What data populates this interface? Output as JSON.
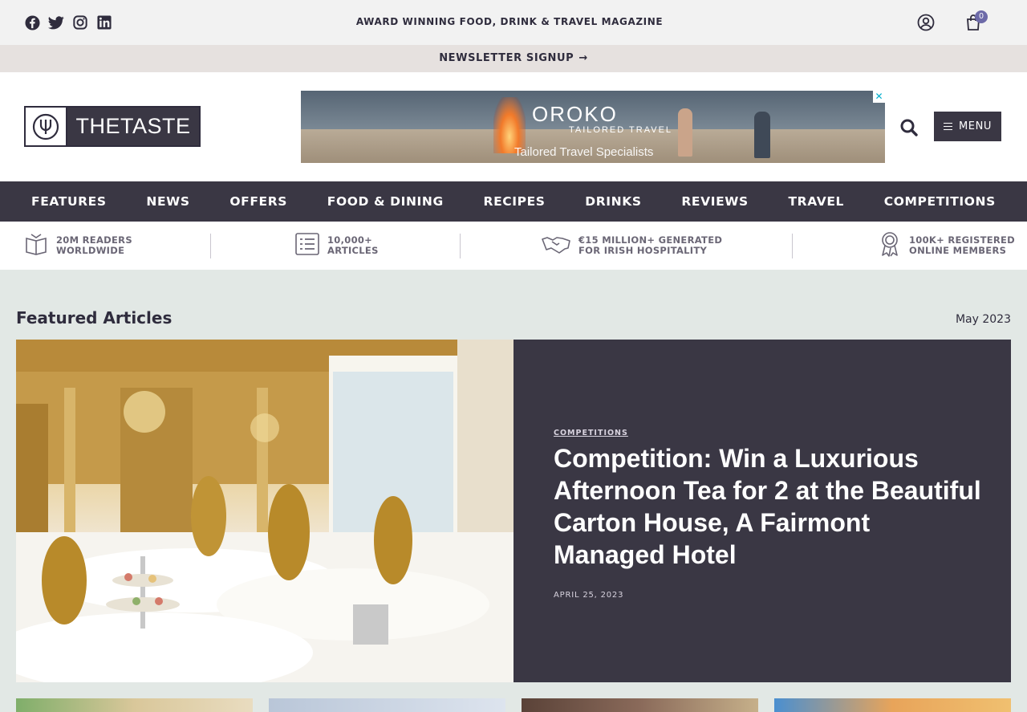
{
  "topbar": {
    "tagline": "AWARD WINNING FOOD, DRINK & TRAVEL MAGAZINE",
    "social": [
      "facebook-icon",
      "twitter-icon",
      "instagram-icon",
      "linkedin-icon"
    ],
    "cart_count": "0"
  },
  "newsletter": {
    "label": "NEWSLETTER SIGNUP",
    "arrow": "→"
  },
  "header": {
    "logo_text": "THETASTE",
    "ad": {
      "brand": "OROKO",
      "brand_sub": "TAILORED TRAVEL",
      "tagline": "Tailored Travel Specialists",
      "close": "✕"
    },
    "menu_label": "MENU"
  },
  "nav": [
    "FEATURES",
    "NEWS",
    "OFFERS",
    "FOOD & DINING",
    "RECIPES",
    "DRINKS",
    "REVIEWS",
    "TRAVEL",
    "COMPETITIONS"
  ],
  "stats": [
    {
      "line1": "20M READERS",
      "line2": "WORLDWIDE",
      "icon": "book-icon"
    },
    {
      "line1": "10,000+",
      "line2": "ARTICLES",
      "icon": "list-icon"
    },
    {
      "line1": "€15 MILLION+ GENERATED",
      "line2": "FOR IRISH HOSPITALITY",
      "icon": "handshake-icon"
    },
    {
      "line1": "100K+ REGISTERED",
      "line2": "ONLINE MEMBERS",
      "icon": "award-icon"
    }
  ],
  "featured": {
    "title": "Featured Articles",
    "date": "May 2023",
    "hero": {
      "category": "COMPETITIONS",
      "headline": "Competition: Win a Luxurious Afternoon Tea for 2 at the Beautiful Carton House, A Fairmont Managed Hotel",
      "date": "APRIL 25, 2023"
    }
  },
  "colors": {
    "dark": "#3a3744",
    "accent": "#6d6aa8",
    "page_bg": "#e2e8e5"
  }
}
